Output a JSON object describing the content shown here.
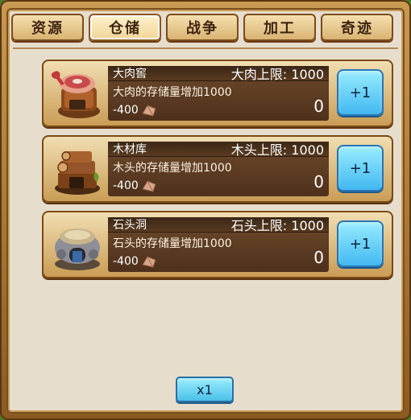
{
  "tabs": [
    {
      "label": "资源"
    },
    {
      "label": "仓储"
    },
    {
      "label": "战争"
    },
    {
      "label": "加工"
    },
    {
      "label": "奇迹"
    }
  ],
  "active_tab": "仓储",
  "buildings": [
    {
      "name": "大肉窖",
      "capacity": "大肉上限: 1000",
      "description": "大肉的存储量增加1000",
      "cost": "-400",
      "count": "0",
      "button": "+1",
      "icon": "meat-cellar-icon"
    },
    {
      "name": "木材库",
      "capacity": "木头上限: 1000",
      "description": "木头的存储量增加1000",
      "cost": "-400",
      "count": "0",
      "button": "+1",
      "icon": "wood-storage-icon"
    },
    {
      "name": "石头洞",
      "capacity": "石头上限: 1000",
      "description": "石头的存储量增加1000",
      "cost": "-400",
      "count": "0",
      "button": "+1",
      "icon": "stone-cave-icon"
    }
  ],
  "multiplier_button": "x1",
  "colors": {
    "accent": "#45bde6",
    "panel": "#e7ddcc",
    "wood": "#c89b52"
  }
}
